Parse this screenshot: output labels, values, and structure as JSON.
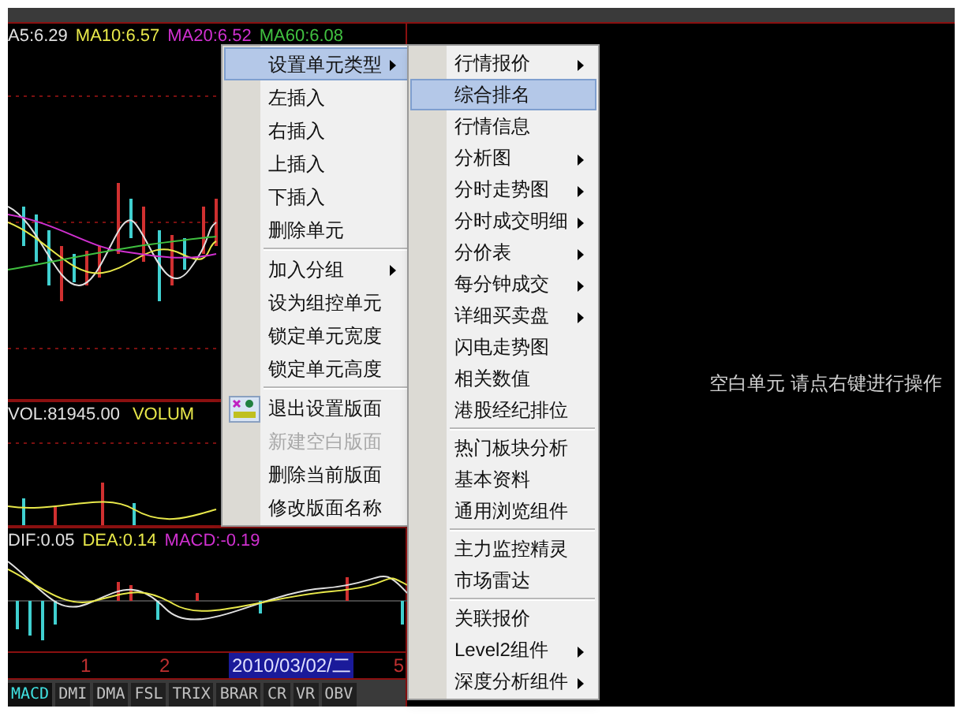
{
  "price_chart": {
    "ma_labels": [
      {
        "text": "A5:6.29",
        "color": "#e0e0e0"
      },
      {
        "text": "MA10:6.57",
        "color": "#e8e84a"
      },
      {
        "text": "MA20:6.52",
        "color": "#d030d0"
      },
      {
        "text": "MA60:6.08",
        "color": "#40c040"
      }
    ]
  },
  "volume_chart": {
    "labels": [
      {
        "text": "VOL:81945.00",
        "color": "#e0e0e0"
      },
      {
        "text": "VOLUM",
        "color": "#e8e84a"
      }
    ]
  },
  "macd_chart": {
    "labels": [
      {
        "text": "DIF:0.05",
        "color": "#e0e0e0"
      },
      {
        "text": "DEA:0.14",
        "color": "#e8e84a"
      },
      {
        "text": "MACD:-0.19",
        "color": "#d030d0"
      }
    ]
  },
  "date_axis": {
    "ticks": [
      "1",
      "2"
    ],
    "current_date": "2010/03/02/二",
    "end_tick": "5"
  },
  "indicator_tabs": [
    {
      "label": "MACD",
      "selected": true
    },
    {
      "label": "DMI",
      "selected": false
    },
    {
      "label": "DMA",
      "selected": false
    },
    {
      "label": "FSL",
      "selected": false
    },
    {
      "label": "TRIX",
      "selected": false
    },
    {
      "label": "BRAR",
      "selected": false
    },
    {
      "label": "CR",
      "selected": false
    },
    {
      "label": "VR",
      "selected": false
    },
    {
      "label": "OBV",
      "selected": false
    }
  ],
  "blank_panel": {
    "message": "空白单元 请点右键进行操作"
  },
  "context_menu": {
    "items": [
      {
        "kind": "item",
        "label": "设置单元类型",
        "submenu": true,
        "selected": true,
        "disabled": false,
        "icon": false
      },
      {
        "kind": "item",
        "label": "左插入",
        "submenu": false,
        "selected": false,
        "disabled": false,
        "icon": false
      },
      {
        "kind": "item",
        "label": "右插入",
        "submenu": false,
        "selected": false,
        "disabled": false,
        "icon": false
      },
      {
        "kind": "item",
        "label": "上插入",
        "submenu": false,
        "selected": false,
        "disabled": false,
        "icon": false
      },
      {
        "kind": "item",
        "label": "下插入",
        "submenu": false,
        "selected": false,
        "disabled": false,
        "icon": false
      },
      {
        "kind": "item",
        "label": "删除单元",
        "submenu": false,
        "selected": false,
        "disabled": false,
        "icon": false
      },
      {
        "kind": "separator"
      },
      {
        "kind": "item",
        "label": "加入分组",
        "submenu": true,
        "selected": false,
        "disabled": false,
        "icon": false
      },
      {
        "kind": "item",
        "label": "设为组控单元",
        "submenu": false,
        "selected": false,
        "disabled": false,
        "icon": false
      },
      {
        "kind": "item",
        "label": "锁定单元宽度",
        "submenu": false,
        "selected": false,
        "disabled": false,
        "icon": false
      },
      {
        "kind": "item",
        "label": "锁定单元高度",
        "submenu": false,
        "selected": false,
        "disabled": false,
        "icon": false
      },
      {
        "kind": "separator"
      },
      {
        "kind": "item",
        "label": "退出设置版面",
        "submenu": false,
        "selected": false,
        "disabled": false,
        "icon": true
      },
      {
        "kind": "item",
        "label": "新建空白版面",
        "submenu": false,
        "selected": false,
        "disabled": true,
        "icon": false
      },
      {
        "kind": "item",
        "label": "删除当前版面",
        "submenu": false,
        "selected": false,
        "disabled": false,
        "icon": false
      },
      {
        "kind": "item",
        "label": "修改版面名称",
        "submenu": false,
        "selected": false,
        "disabled": false,
        "icon": false
      }
    ]
  },
  "submenu": {
    "items": [
      {
        "kind": "item",
        "label": "行情报价",
        "submenu": true,
        "selected": false
      },
      {
        "kind": "item",
        "label": "综合排名",
        "submenu": false,
        "selected": true
      },
      {
        "kind": "item",
        "label": "行情信息",
        "submenu": false,
        "selected": false
      },
      {
        "kind": "item",
        "label": "分析图",
        "submenu": true,
        "selected": false
      },
      {
        "kind": "item",
        "label": "分时走势图",
        "submenu": true,
        "selected": false
      },
      {
        "kind": "item",
        "label": "分时成交明细",
        "submenu": true,
        "selected": false
      },
      {
        "kind": "item",
        "label": "分价表",
        "submenu": true,
        "selected": false
      },
      {
        "kind": "item",
        "label": "每分钟成交",
        "submenu": true,
        "selected": false
      },
      {
        "kind": "item",
        "label": "详细买卖盘",
        "submenu": true,
        "selected": false
      },
      {
        "kind": "item",
        "label": "闪电走势图",
        "submenu": false,
        "selected": false
      },
      {
        "kind": "item",
        "label": "相关数值",
        "submenu": false,
        "selected": false
      },
      {
        "kind": "item",
        "label": "港股经纪排位",
        "submenu": false,
        "selected": false
      },
      {
        "kind": "separator"
      },
      {
        "kind": "item",
        "label": "热门板块分析",
        "submenu": false,
        "selected": false
      },
      {
        "kind": "item",
        "label": "基本资料",
        "submenu": false,
        "selected": false
      },
      {
        "kind": "item",
        "label": "通用浏览组件",
        "submenu": false,
        "selected": false
      },
      {
        "kind": "separator"
      },
      {
        "kind": "item",
        "label": "主力监控精灵",
        "submenu": false,
        "selected": false
      },
      {
        "kind": "item",
        "label": "市场雷达",
        "submenu": false,
        "selected": false
      },
      {
        "kind": "separator"
      },
      {
        "kind": "item",
        "label": "关联报价",
        "submenu": false,
        "selected": false
      },
      {
        "kind": "item",
        "label": "Level2组件",
        "submenu": true,
        "selected": false
      },
      {
        "kind": "item",
        "label": "深度分析组件",
        "submenu": true,
        "selected": false
      }
    ]
  }
}
